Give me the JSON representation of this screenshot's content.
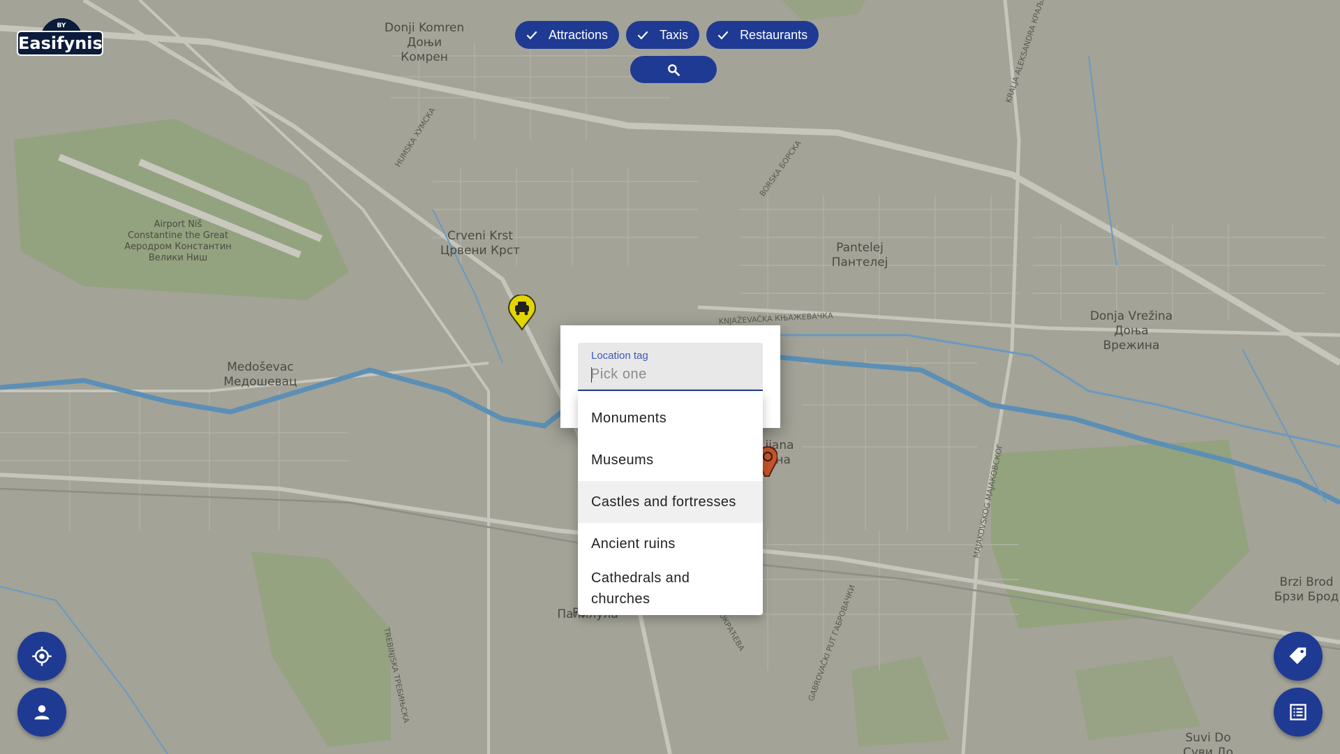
{
  "logo": {
    "badge": "BY",
    "wordmark": "Easifynis"
  },
  "filters": [
    {
      "label": "Attractions",
      "checked": true
    },
    {
      "label": "Taxis",
      "checked": true
    },
    {
      "label": "Restaurants",
      "checked": true
    }
  ],
  "search": {
    "icon": "search-icon"
  },
  "map": {
    "places": [
      {
        "line1": "Donji Komren",
        "line2": "Доњи",
        "line3": "Комрен"
      },
      {
        "line1": "Airport Niš",
        "line2": "Constantine the Great",
        "line3": "Аеродром Константин",
        "line4": "Велики Ниш"
      },
      {
        "line1": "Crveni Krst",
        "line2": "Црвени Крст"
      },
      {
        "line1": "Pantelej",
        "line2": "Пантелеј"
      },
      {
        "line1": "Donja Vrežina",
        "line2": "Доња",
        "line3": "Врежина"
      },
      {
        "line1": "Medoševac",
        "line2": "Медошевац"
      },
      {
        "line1": "Brzi Brod",
        "line2": "Брзи Брод"
      },
      {
        "line1": "Suvi Do",
        "line2": "Суви До"
      },
      {
        "line1": "ijana",
        "line2": "ана"
      },
      {
        "line1": "Pa",
        "line2": "Палилула"
      }
    ],
    "roads": [
      "HUMSKA ХУМСКА",
      "BORSKA БОРСКА",
      "KNJAŽEVAČKA КЊАЖЕВАЧКА",
      "MAJAKOVSKOG МАЈАКОВСКОГ",
      "GABROVAČKI PUT ГАБРОВАЧКИ",
      "TREBINJSKA ТРЕБИЊСКА",
      "KRALJA ALEKSANDRA КРАЉА А",
      "ОКРАЋЕВА"
    ]
  },
  "dialog": {
    "field_label": "Location tag",
    "placeholder": "Pick one",
    "options": [
      "Monuments",
      "Museums",
      "Castles and fortresses",
      "Ancient ruins",
      "Cathedrals and churches"
    ]
  },
  "fabs": {
    "left_top": "crosshair-icon",
    "left_bottom": "person-icon",
    "right_top": "tag-icon",
    "right_bottom": "list-icon"
  },
  "colors": {
    "accent": "#1f3a93",
    "map_bg": "#a3a398",
    "water": "#5b8fb6",
    "park": "#8fa377",
    "taxi_marker": "#e3d600",
    "restaurant_marker": "#c4542a"
  }
}
